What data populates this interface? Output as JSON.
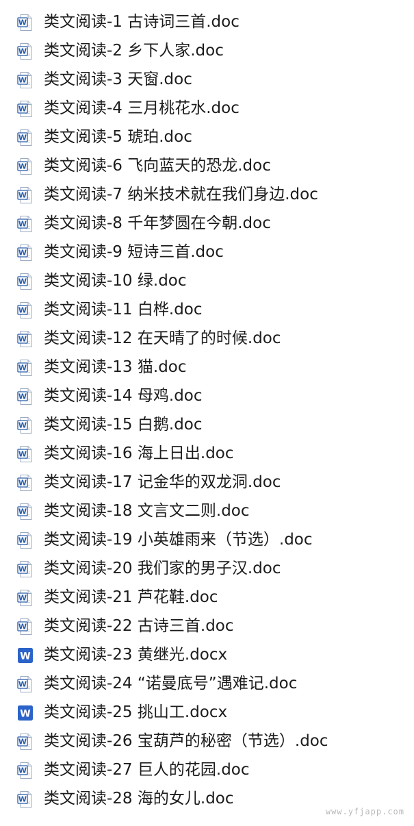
{
  "files": [
    {
      "name": "类文阅读-1 古诗词三首.doc",
      "icon": "word-doc-icon"
    },
    {
      "name": "类文阅读-2 乡下人家.doc",
      "icon": "word-doc-icon"
    },
    {
      "name": "类文阅读-3 天窗.doc",
      "icon": "word-doc-icon"
    },
    {
      "name": "类文阅读-4 三月桃花水.doc",
      "icon": "word-doc-icon"
    },
    {
      "name": "类文阅读-5 琥珀.doc",
      "icon": "word-doc-icon"
    },
    {
      "name": "类文阅读-6 飞向蓝天的恐龙.doc",
      "icon": "word-doc-icon"
    },
    {
      "name": "类文阅读-7 纳米技术就在我们身边.doc",
      "icon": "word-doc-icon"
    },
    {
      "name": "类文阅读-8 千年梦圆在今朝.doc",
      "icon": "word-doc-icon"
    },
    {
      "name": "类文阅读-9 短诗三首.doc",
      "icon": "word-doc-icon"
    },
    {
      "name": "类文阅读-10 绿.doc",
      "icon": "word-doc-icon"
    },
    {
      "name": "类文阅读-11 白桦.doc",
      "icon": "word-doc-icon"
    },
    {
      "name": "类文阅读-12 在天晴了的时候.doc",
      "icon": "word-doc-icon"
    },
    {
      "name": "类文阅读-13 猫.doc",
      "icon": "word-doc-icon"
    },
    {
      "name": "类文阅读-14 母鸡.doc",
      "icon": "word-doc-icon"
    },
    {
      "name": "类文阅读-15 白鹅.doc",
      "icon": "word-doc-icon"
    },
    {
      "name": "类文阅读-16 海上日出.doc",
      "icon": "word-doc-icon"
    },
    {
      "name": "类文阅读-17 记金华的双龙洞.doc",
      "icon": "word-doc-icon"
    },
    {
      "name": "类文阅读-18 文言文二则.doc",
      "icon": "word-doc-icon"
    },
    {
      "name": "类文阅读-19 小英雄雨来（节选）.doc",
      "icon": "word-doc-icon"
    },
    {
      "name": "类文阅读-20 我们家的男子汉.doc",
      "icon": "word-doc-icon"
    },
    {
      "name": "类文阅读-21 芦花鞋.doc",
      "icon": "word-doc-icon"
    },
    {
      "name": "类文阅读-22 古诗三首.doc",
      "icon": "word-doc-icon"
    },
    {
      "name": "类文阅读-23 黄继光.docx",
      "icon": "word-docx-icon"
    },
    {
      "name": "类文阅读-24 “诺曼底号”遇难记.doc",
      "icon": "word-doc-icon"
    },
    {
      "name": "类文阅读-25 挑山工.docx",
      "icon": "word-docx-icon"
    },
    {
      "name": "类文阅读-26 宝葫芦的秘密（节选）.doc",
      "icon": "word-doc-icon"
    },
    {
      "name": "类文阅读-27 巨人的花园.doc",
      "icon": "word-doc-icon"
    },
    {
      "name": "类文阅读-28 海的女儿.doc",
      "icon": "word-doc-icon"
    }
  ],
  "watermark": "www.yfjapp.com",
  "colors": {
    "doc_icon_blue": "#2a5ca8",
    "docx_icon_blue": "#2b63c9",
    "text": "#1c1c1c",
    "watermark": "#b9b9b9"
  }
}
